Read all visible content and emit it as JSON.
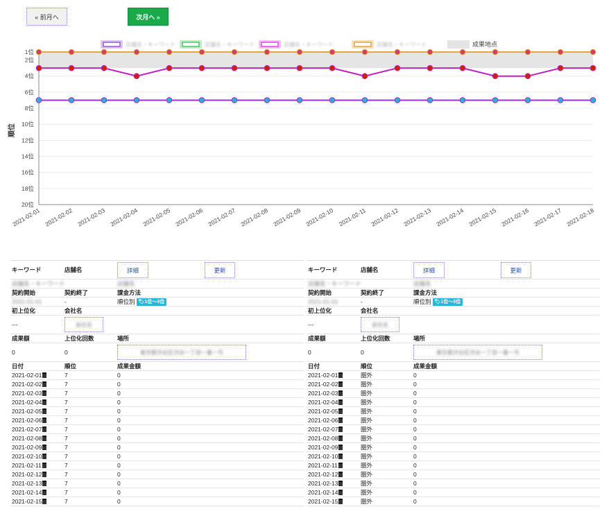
{
  "nav": {
    "prev_label": "« 前月へ",
    "next_label": "次月へ »"
  },
  "legend": {
    "items": [
      {
        "name": "店舗名・キーワード",
        "color": "#9b59d0"
      },
      {
        "name": "店舗名・キーワード",
        "color": "#4cc764"
      },
      {
        "name": "店舗名・キーワード",
        "color": "#d84fd8"
      },
      {
        "name": "店舗名・キーワード",
        "color": "#e0a640"
      }
    ],
    "goal_label": "成果地点"
  },
  "chart_data": {
    "type": "line",
    "ylabel": "順位",
    "xlabel": "",
    "y_reversed": true,
    "ylim": [
      1,
      20
    ],
    "yticks": [
      "1位",
      "2位",
      "4位",
      "6位",
      "8位",
      "10位",
      "12位",
      "14位",
      "16位",
      "18位",
      "20位"
    ],
    "x": [
      "2021-02-01",
      "2021-02-02",
      "2021-02-03",
      "2021-02-04",
      "2021-02-05",
      "2021-02-06",
      "2021-02-07",
      "2021-02-08",
      "2021-02-09",
      "2021-02-10",
      "2021-02-11",
      "2021-02-12",
      "2021-02-13",
      "2021-02-14",
      "2021-02-15",
      "2021-02-16",
      "2021-02-17",
      "2021-02-18"
    ],
    "goal_band": [
      1,
      3
    ],
    "series": [
      {
        "color": "#e0a640",
        "marker": "#d04060",
        "values": [
          1,
          1,
          1,
          1,
          1,
          1,
          1,
          1,
          1,
          1,
          1,
          1,
          1,
          1,
          1,
          1,
          1,
          1
        ]
      },
      {
        "color": "#c020c0",
        "marker": "#cc2200",
        "values": [
          3,
          3,
          3,
          4,
          3,
          3,
          3,
          3,
          3,
          3,
          4,
          3,
          3,
          3,
          4,
          4,
          3,
          3
        ]
      },
      {
        "color": "#9b30d0",
        "marker": "#2cb0d0",
        "values": [
          7,
          7,
          7,
          7,
          7,
          7,
          7,
          7,
          7,
          7,
          7,
          7,
          7,
          7,
          7,
          7,
          7,
          7
        ]
      }
    ]
  },
  "panels": [
    {
      "headers": {
        "keyword": "キーワード",
        "shop": "店舗名",
        "detail": "詳細",
        "update": "更新"
      },
      "keyword_value": "店舗名・キーワード",
      "shop_value": "店舗名",
      "contract_labels": {
        "start": "契約開始",
        "end": "契約終了",
        "billing": "課金方法"
      },
      "contract_start": "2021-01-01",
      "contract_end": "-",
      "billing_value": "順位別",
      "billing_badge": "1位〜3位",
      "first_labels": {
        "first_rank": "初上位化",
        "company": "会社名"
      },
      "first_rank_value": "---",
      "company_value": "会社名",
      "result_labels": {
        "amount": "成果額",
        "count": "上位化回数",
        "place": "場所"
      },
      "amount_value": "0",
      "count_value": "0",
      "place_value": "東京都渋谷区渋谷一丁目一番一号",
      "table_headers": {
        "date": "日付",
        "rank": "順位",
        "amount": "成果金額"
      },
      "rows": [
        {
          "date": "2021-02-01",
          "rank": "7",
          "amount": "0"
        },
        {
          "date": "2021-02-02",
          "rank": "7",
          "amount": "0"
        },
        {
          "date": "2021-02-03",
          "rank": "7",
          "amount": "0"
        },
        {
          "date": "2021-02-04",
          "rank": "7",
          "amount": "0"
        },
        {
          "date": "2021-02-05",
          "rank": "7",
          "amount": "0"
        },
        {
          "date": "2021-02-06",
          "rank": "7",
          "amount": "0"
        },
        {
          "date": "2021-02-07",
          "rank": "7",
          "amount": "0"
        },
        {
          "date": "2021-02-08",
          "rank": "7",
          "amount": "0"
        },
        {
          "date": "2021-02-09",
          "rank": "7",
          "amount": "0"
        },
        {
          "date": "2021-02-10",
          "rank": "7",
          "amount": "0"
        },
        {
          "date": "2021-02-11",
          "rank": "7",
          "amount": "0"
        },
        {
          "date": "2021-02-12",
          "rank": "7",
          "amount": "0"
        },
        {
          "date": "2021-02-13",
          "rank": "7",
          "amount": "0"
        },
        {
          "date": "2021-02-14",
          "rank": "7",
          "amount": "0"
        },
        {
          "date": "2021-02-15",
          "rank": "7",
          "amount": "0"
        }
      ]
    },
    {
      "headers": {
        "keyword": "キーワード",
        "shop": "店舗名",
        "detail": "詳細",
        "update": "更新"
      },
      "keyword_value": "店舗名・キーワード",
      "shop_value": "店舗名",
      "contract_labels": {
        "start": "契約開始",
        "end": "契約終了",
        "billing": "課金方法"
      },
      "contract_start": "2021-01-01",
      "contract_end": "-",
      "billing_value": "順位別",
      "billing_badge": "1位〜3位",
      "first_labels": {
        "first_rank": "初上位化",
        "company": "会社名"
      },
      "first_rank_value": "---",
      "company_value": "会社名",
      "result_labels": {
        "amount": "成果額",
        "count": "上位化回数",
        "place": "場所"
      },
      "amount_value": "0",
      "count_value": "0",
      "place_value": "東京都渋谷区渋谷一丁目一番一号",
      "table_headers": {
        "date": "日付",
        "rank": "順位",
        "amount": "成果金額"
      },
      "rows": [
        {
          "date": "2021-02-01",
          "rank": "圏外",
          "amount": "0"
        },
        {
          "date": "2021-02-02",
          "rank": "圏外",
          "amount": "0"
        },
        {
          "date": "2021-02-03",
          "rank": "圏外",
          "amount": "0"
        },
        {
          "date": "2021-02-04",
          "rank": "圏外",
          "amount": "0"
        },
        {
          "date": "2021-02-05",
          "rank": "圏外",
          "amount": "0"
        },
        {
          "date": "2021-02-06",
          "rank": "圏外",
          "amount": "0"
        },
        {
          "date": "2021-02-07",
          "rank": "圏外",
          "amount": "0"
        },
        {
          "date": "2021-02-08",
          "rank": "圏外",
          "amount": "0"
        },
        {
          "date": "2021-02-09",
          "rank": "圏外",
          "amount": "0"
        },
        {
          "date": "2021-02-10",
          "rank": "圏外",
          "amount": "0"
        },
        {
          "date": "2021-02-11",
          "rank": "圏外",
          "amount": "0"
        },
        {
          "date": "2021-02-12",
          "rank": "圏外",
          "amount": "0"
        },
        {
          "date": "2021-02-13",
          "rank": "圏外",
          "amount": "0"
        },
        {
          "date": "2021-02-14",
          "rank": "圏外",
          "amount": "0"
        },
        {
          "date": "2021-02-15",
          "rank": "圏外",
          "amount": "0"
        }
      ]
    }
  ]
}
